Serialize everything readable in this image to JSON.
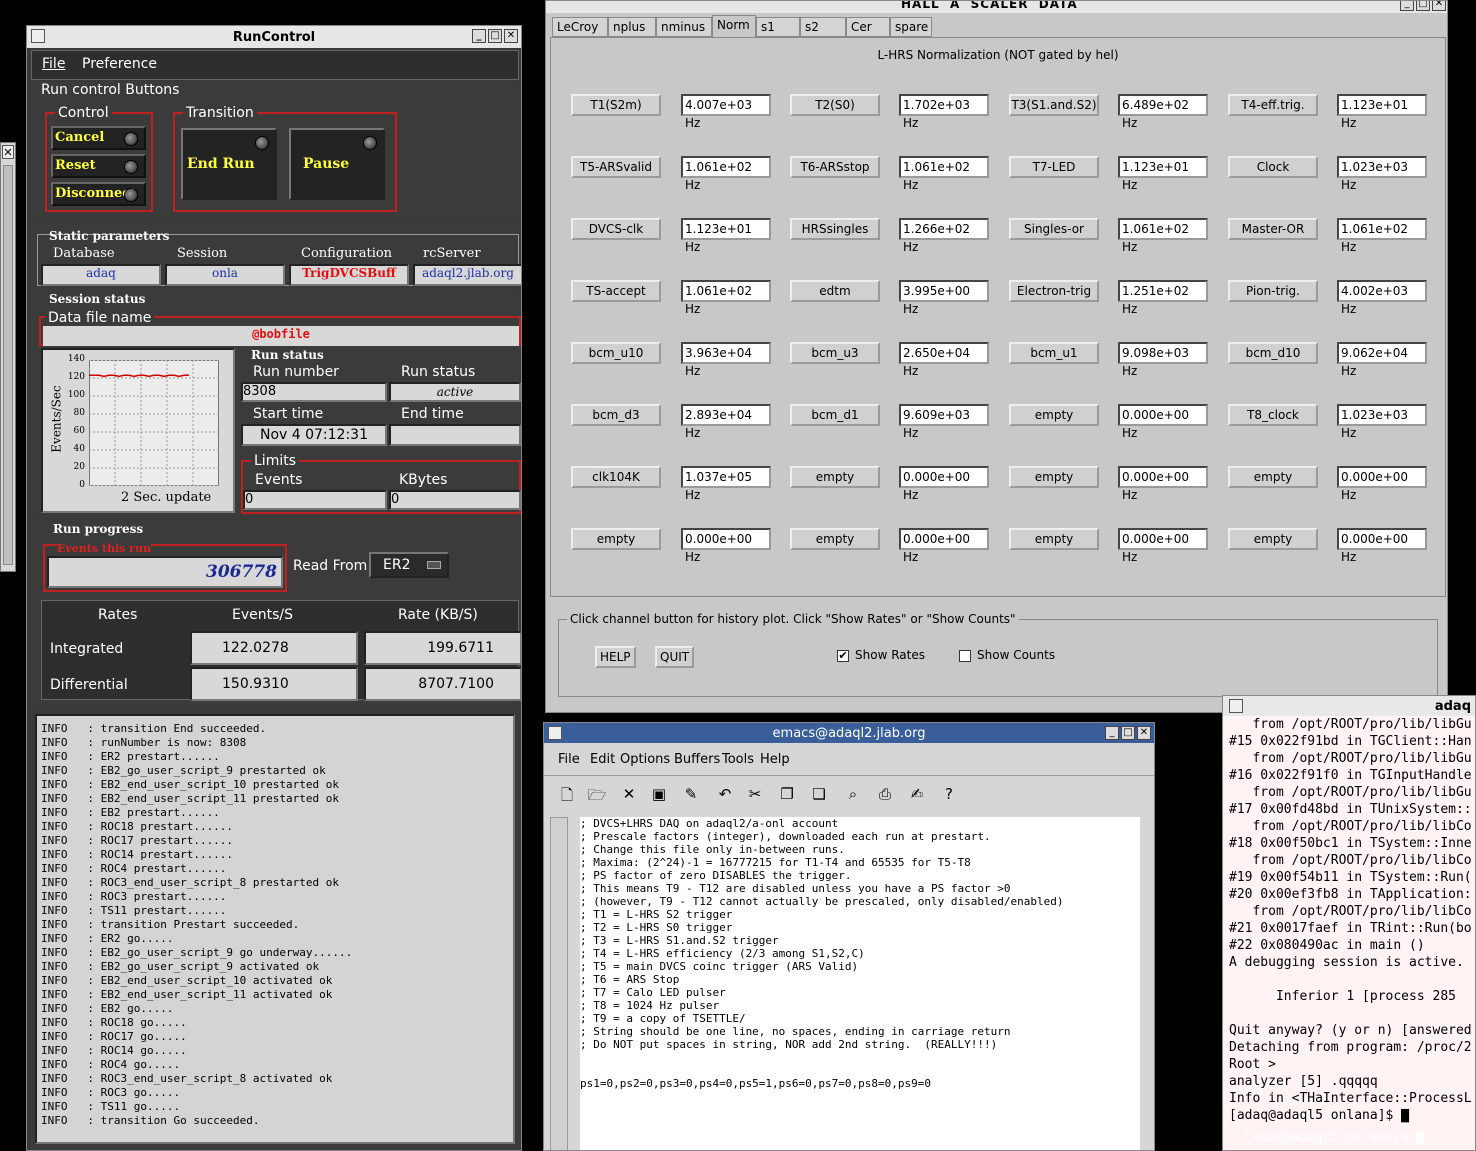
{
  "runcontrol": {
    "title": "RunControl",
    "menu": [
      "File",
      "Preference"
    ],
    "run_control_buttons_label": "Run control Buttons",
    "control_label": "Control",
    "control_buttons": [
      "Cancel",
      "Reset",
      "Disconnect"
    ],
    "transition_label": "Transition",
    "transition_buttons": [
      "End Run",
      "Pause"
    ],
    "static_params_label": "Static parameters",
    "static_params": {
      "database_label": "Database",
      "database": "adaq",
      "session_label": "Session",
      "session": "onla",
      "config_label": "Configuration",
      "config": "TrigDVCSBuff",
      "rcserver_label": "rcServer",
      "rcserver": "adaql2.jlab.org"
    },
    "session_status_label": "Session status",
    "data_file_label": "Data file name",
    "data_file": "@bobfile",
    "graph": {
      "ylabel": "Events/Sec",
      "yticks": [
        "140",
        "120",
        "100",
        "80",
        "60",
        "40",
        "20",
        "0"
      ],
      "update_label": "2 Sec. update",
      "rate_level": 123
    },
    "run_status_label": "Run status",
    "run_number_label": "Run number",
    "run_number": "8308",
    "run_state_label": "Run status",
    "run_state": "active",
    "start_time_label": "Start time",
    "start_time": "Nov 4 07:12:31",
    "end_time_label": "End time",
    "end_time": "",
    "limits_label": "Limits",
    "events_label": "Events",
    "events_limit": "0",
    "kbytes_label": "KBytes",
    "kbytes_limit": "0",
    "run_progress_label": "Run progress",
    "events_this_run_label": "Events this run",
    "events_this_run": "306778",
    "read_from_label": "Read From:",
    "read_from": "ER2",
    "rates_header": [
      "Rates",
      "Events/S",
      "Rate (KB/S)"
    ],
    "rates_rows": [
      {
        "label": "Integrated",
        "events": "122.0278",
        "kb": "199.6711"
      },
      {
        "label": "Differential",
        "events": "150.9310",
        "kb": "8707.7100"
      }
    ],
    "log": [
      "INFO   : transition End succeeded.",
      "INFO   : runNumber is now: 8308",
      "INFO   : ER2 prestart......",
      "INFO   : EB2_go_user_script_9 prestarted ok",
      "INFO   : EB2_end_user_script_10 prestarted ok",
      "INFO   : EB2_end_user_script_11 prestarted ok",
      "INFO   : EB2 prestart......",
      "INFO   : ROC18 prestart......",
      "INFO   : ROC17 prestart......",
      "INFO   : ROC14 prestart......",
      "INFO   : ROC4 prestart......",
      "INFO   : ROC3_end_user_script_8 prestarted ok",
      "INFO   : ROC3 prestart......",
      "INFO   : TS11 prestart......",
      "INFO   : transition Prestart succeeded.",
      "INFO   : ER2 go.....",
      "INFO   : EB2_go_user_script_9 go underway......",
      "INFO   : EB2_go_user_script_9 activated ok",
      "INFO   : EB2_end_user_script_10 activated ok",
      "INFO   : EB2_end_user_script_11 activated ok",
      "INFO   : EB2 go.....",
      "INFO   : ROC18 go.....",
      "INFO   : ROC17 go.....",
      "INFO   : ROC14 go.....",
      "INFO   : ROC4 go.....",
      "INFO   : ROC3_end_user_script_8 activated ok",
      "INFO   : ROC3 go.....",
      "INFO   : TS11 go.....",
      "INFO   : transition Go succeeded."
    ]
  },
  "scaler": {
    "title": "HALL  A  SCALER  DATA",
    "tabs": [
      "LeCroy",
      "nplus",
      "nminus",
      "Norm",
      "s1",
      "s2",
      "Cer",
      "spare"
    ],
    "active_tab": "Norm",
    "heading": "L-HRS Normalization (NOT gated by hel)",
    "rows": [
      [
        [
          "T1(S2m)",
          "4.007e+03 Hz"
        ],
        [
          "T2(S0)",
          "1.702e+03 Hz"
        ],
        [
          "T3(S1.and.S2)",
          "6.489e+02 Hz"
        ],
        [
          "T4-eff.trig.",
          "1.123e+01 Hz"
        ]
      ],
      [
        [
          "T5-ARSvalid",
          "1.061e+02 Hz"
        ],
        [
          "T6-ARSstop",
          "1.061e+02 Hz"
        ],
        [
          "T7-LED",
          "1.123e+01 Hz"
        ],
        [
          "Clock",
          "1.023e+03 Hz"
        ]
      ],
      [
        [
          "DVCS-clk",
          "1.123e+01 Hz"
        ],
        [
          "HRSsingles",
          "1.266e+02 Hz"
        ],
        [
          "Singles-or",
          "1.061e+02 Hz"
        ],
        [
          "Master-OR",
          "1.061e+02 Hz"
        ]
      ],
      [
        [
          "TS-accept",
          "1.061e+02 Hz"
        ],
        [
          "edtm",
          "3.995e+00 Hz"
        ],
        [
          "Electron-trig",
          "1.251e+02 Hz"
        ],
        [
          "Pion-trig.",
          "4.002e+03 Hz"
        ]
      ],
      [
        [
          "bcm_u10",
          "3.963e+04 Hz"
        ],
        [
          "bcm_u3",
          "2.650e+04 Hz"
        ],
        [
          "bcm_u1",
          "9.098e+03 Hz"
        ],
        [
          "bcm_d10",
          "9.062e+04 Hz"
        ]
      ],
      [
        [
          "bcm_d3",
          "2.893e+04 Hz"
        ],
        [
          "bcm_d1",
          "9.609e+03 Hz"
        ],
        [
          "empty",
          "0.000e+00 Hz"
        ],
        [
          "T8_clock",
          "1.023e+03 Hz"
        ]
      ],
      [
        [
          "clk104K",
          "1.037e+05 Hz"
        ],
        [
          "empty",
          "0.000e+00 Hz"
        ],
        [
          "empty",
          "0.000e+00 Hz"
        ],
        [
          "empty",
          "0.000e+00 Hz"
        ]
      ],
      [
        [
          "empty",
          "0.000e+00 Hz"
        ],
        [
          "empty",
          "0.000e+00 Hz"
        ],
        [
          "empty",
          "0.000e+00 Hz"
        ],
        [
          "empty",
          "0.000e+00 Hz"
        ]
      ]
    ],
    "instructions": "Click channel button for history plot.  Click \"Show Rates\" or \"Show Counts\"",
    "help_label": "HELP",
    "quit_label": "QUIT",
    "show_rates_label": "Show Rates",
    "show_rates_checked": true,
    "show_counts_label": "Show Counts",
    "show_counts_checked": false
  },
  "emacs": {
    "title": "emacs@adaql2.jlab.org",
    "menu": [
      "File",
      "Edit",
      "Options",
      "Buffers",
      "Tools",
      "Help"
    ],
    "lines": [
      "; DVCS+LHRS DAQ on adaql2/a-onl account",
      "; Prescale factors (integer), downloaded each run at prestart.",
      "; Change this file only in-between runs.",
      "; Maxima: (2^24)-1 = 16777215 for T1-T4 and 65535 for T5-T8",
      "; PS factor of zero DISABLES the trigger.",
      "; This means T9 - T12 are disabled unless you have a PS factor >0",
      "; (however, T9 - T12 cannot actually be prescaled, only disabled/enabled)",
      "; T1 = L-HRS S2 trigger",
      "; T2 = L-HRS S0 trigger",
      "; T3 = L-HRS S1.and.S2 trigger",
      "; T4 = L-HRS efficiency (2/3 among S1,S2,C)",
      "; T5 = main DVCS coinc trigger (ARS Valid)",
      "; T6 = ARS Stop",
      "; T7 = Calo LED pulser",
      "; T8 = 1024 Hz pulser",
      "; T9 = a copy of TSETTLE/",
      "; String should be one line, no spaces, ending in carriage return",
      "; Do NOT put spaces in string, NOR add 2nd string.  (REALLY!!!)",
      "",
      "",
      "ps1=0,ps2=0,ps3=0,ps4=0,ps5=1,ps6=0,ps7=0,ps8=0,ps9=0"
    ]
  },
  "terminal": {
    "title": "adaq",
    "lines": [
      "   from /opt/ROOT/pro/lib/libGu",
      "#15 0x022f91bd in TGClient::Han",
      "   from /opt/ROOT/pro/lib/libGu",
      "#16 0x022f91f0 in TGInputHandle",
      "   from /opt/ROOT/pro/lib/libGu",
      "#17 0x00fd48bd in TUnixSystem::",
      "   from /opt/ROOT/pro/lib/libCo",
      "#18 0x00f50bc1 in TSystem::Inne",
      "   from /opt/ROOT/pro/lib/libCo",
      "#19 0x00f54b11 in TSystem::Run(",
      "#20 0x00ef3fb8 in TApplication:",
      "   from /opt/ROOT/pro/lib/libCo",
      "#21 0x0017faef in TRint::Run(bo",
      "#22 0x080490ac in main ()",
      "A debugging session is active.",
      "",
      "      Inferior 1 [process 285",
      "",
      "Quit anyway? (y or n) [answered",
      "Detaching from program: /proc/2",
      "Root >",
      "analyzer [5] .qqqqq",
      "Info in <THaInterface::ProcessL",
      "[adaq@adaql5 onlana]$ ▇"
    ],
    "bottom_prompt": "[adaq@adaql5 onlana]$ ▇"
  }
}
